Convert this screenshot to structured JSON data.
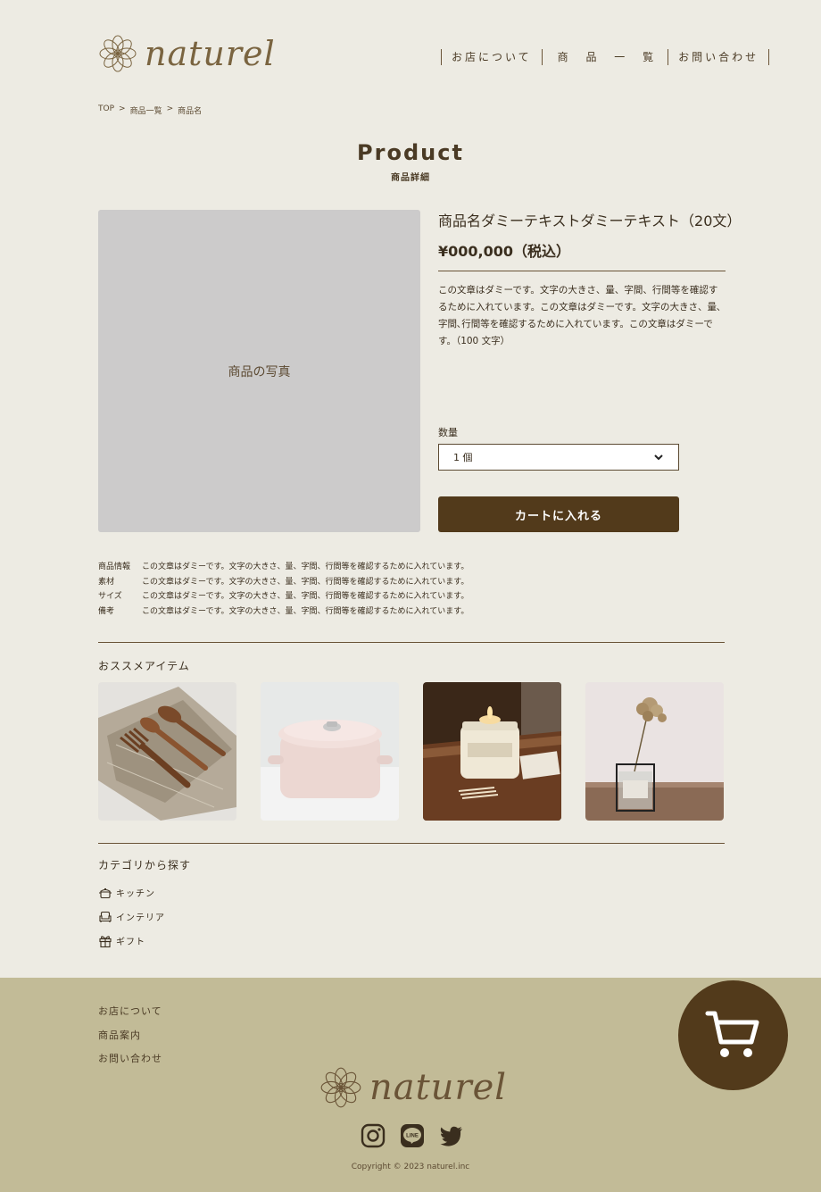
{
  "brand": {
    "name": "naturel"
  },
  "nav": {
    "items": [
      "お店について",
      "商 品 一 覧",
      "お問い合わせ"
    ]
  },
  "breadcrumb": {
    "items": [
      "TOP",
      "商品一覧",
      "商品名"
    ],
    "separator": ">"
  },
  "page": {
    "title": "Product",
    "subtitle": "商品詳細"
  },
  "product": {
    "photo_label": "商品の写真",
    "name": "商品名ダミーテキストダミーテキスト（20文）",
    "price": "¥000,000（税込）",
    "description": "この文章はダミーです。文字の大きさ、量、字間、行間等を確認するために入れています。この文章はダミーです。文字の大きさ、量､字間､行間等を確認するために入れています。この文章はダミーです。（100 文字）",
    "quantity_label": "数量",
    "quantity_value": "1 個",
    "cart_button": "カートに入れる"
  },
  "info": [
    {
      "key": "商品情報",
      "value": "この文章はダミーです。文字の大きさ、量、字間、行間等を確認するために入れています。"
    },
    {
      "key": "素材",
      "value": "この文章はダミーです。文字の大きさ、量、字間、行間等を確認するために入れています。"
    },
    {
      "key": "サイズ",
      "value": "この文章はダミーです。文字の大きさ、量、字間、行間等を確認するために入れています。"
    },
    {
      "key": "備考",
      "value": "この文章はダミーです。文字の大きさ、量、字間、行間等を確認するために入れています。"
    }
  ],
  "recommend": {
    "heading": "おススメアイテム",
    "items": [
      "cutlery-roll",
      "pink-pot",
      "candle-jar",
      "dried-flower-vase"
    ]
  },
  "categories": {
    "heading": "カテゴリから探す",
    "items": [
      {
        "label": "キッチン",
        "icon": "pot-icon"
      },
      {
        "label": "インテリア",
        "icon": "sofa-icon"
      },
      {
        "label": "ギフト",
        "icon": "gift-icon"
      }
    ]
  },
  "footer": {
    "links": [
      "お店について",
      "商品案内",
      "お問い合わせ"
    ],
    "socials": [
      "instagram-icon",
      "line-icon",
      "twitter-icon"
    ],
    "copyright": "Copyright © 2023 naturel.inc"
  },
  "colors": {
    "background": "#edebe3",
    "accent": "#523a1b",
    "footer": "#c2bb97",
    "text": "#4a3a24"
  }
}
